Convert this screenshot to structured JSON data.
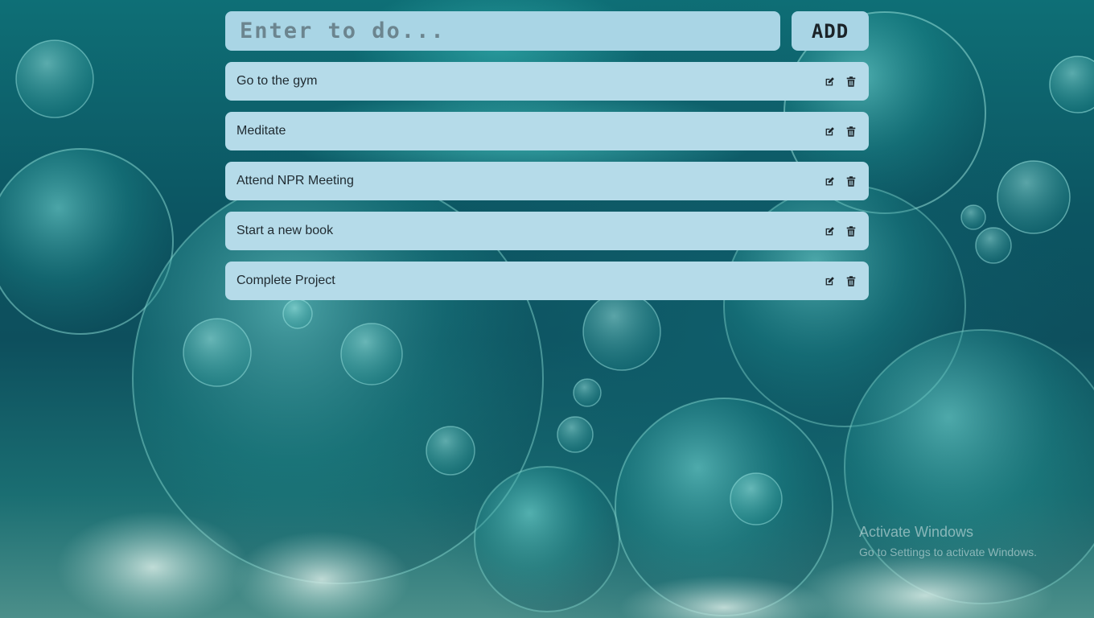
{
  "input": {
    "placeholder": "Enter to do...",
    "value": ""
  },
  "add_button": {
    "label": "ADD"
  },
  "todos": [
    {
      "text": "Go to the gym"
    },
    {
      "text": "Meditate"
    },
    {
      "text": "Attend NPR Meeting"
    },
    {
      "text": "Start a new book"
    },
    {
      "text": "Complete Project"
    }
  ],
  "icons": {
    "edit": "edit-icon",
    "delete": "trash-icon"
  },
  "watermark": {
    "title": "Activate Windows",
    "subtitle": "Go to Settings to activate Windows."
  },
  "colors": {
    "item_background": "#b5dbe9",
    "input_background": "#a9d5e5",
    "text": "#1f2a30"
  }
}
